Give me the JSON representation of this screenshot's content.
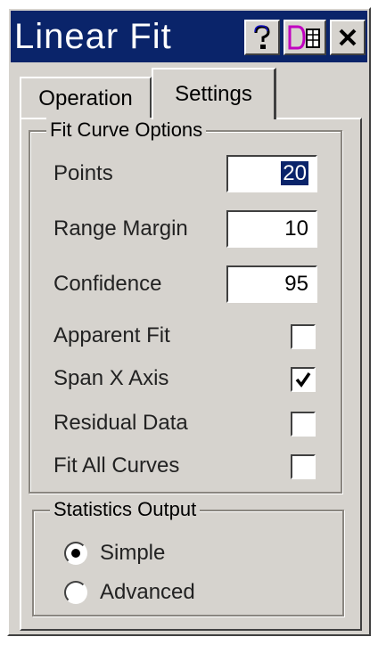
{
  "window": {
    "title": "Linear Fit"
  },
  "titlebar_buttons": [
    {
      "name": "help",
      "icon": "question-mark-icon"
    },
    {
      "name": "data",
      "icon": "data-export-icon",
      "label": "D"
    },
    {
      "name": "close",
      "icon": "close-icon",
      "label": "✕"
    }
  ],
  "tabs": [
    {
      "label": "Operation",
      "active": false
    },
    {
      "label": "Settings",
      "active": true
    }
  ],
  "fit_curve_options": {
    "legend": "Fit Curve Options",
    "fields": [
      {
        "label": "Points",
        "value": "20",
        "selected": true
      },
      {
        "label": "Range Margin",
        "value": "10",
        "selected": false
      },
      {
        "label": "Confidence",
        "value": "95",
        "selected": false
      }
    ],
    "checkboxes": [
      {
        "label": "Apparent Fit",
        "checked": false
      },
      {
        "label": "Span X Axis",
        "checked": true
      },
      {
        "label": "Residual Data",
        "checked": false
      },
      {
        "label": "Fit All Curves",
        "checked": false
      }
    ]
  },
  "statistics_output": {
    "legend": "Statistics Output",
    "options": [
      {
        "label": "Simple",
        "selected": true
      },
      {
        "label": "Advanced",
        "selected": false
      }
    ]
  },
  "colors": {
    "titlebar": "#0a246a",
    "face": "#d6d3ce",
    "selection": "#0a246a"
  }
}
